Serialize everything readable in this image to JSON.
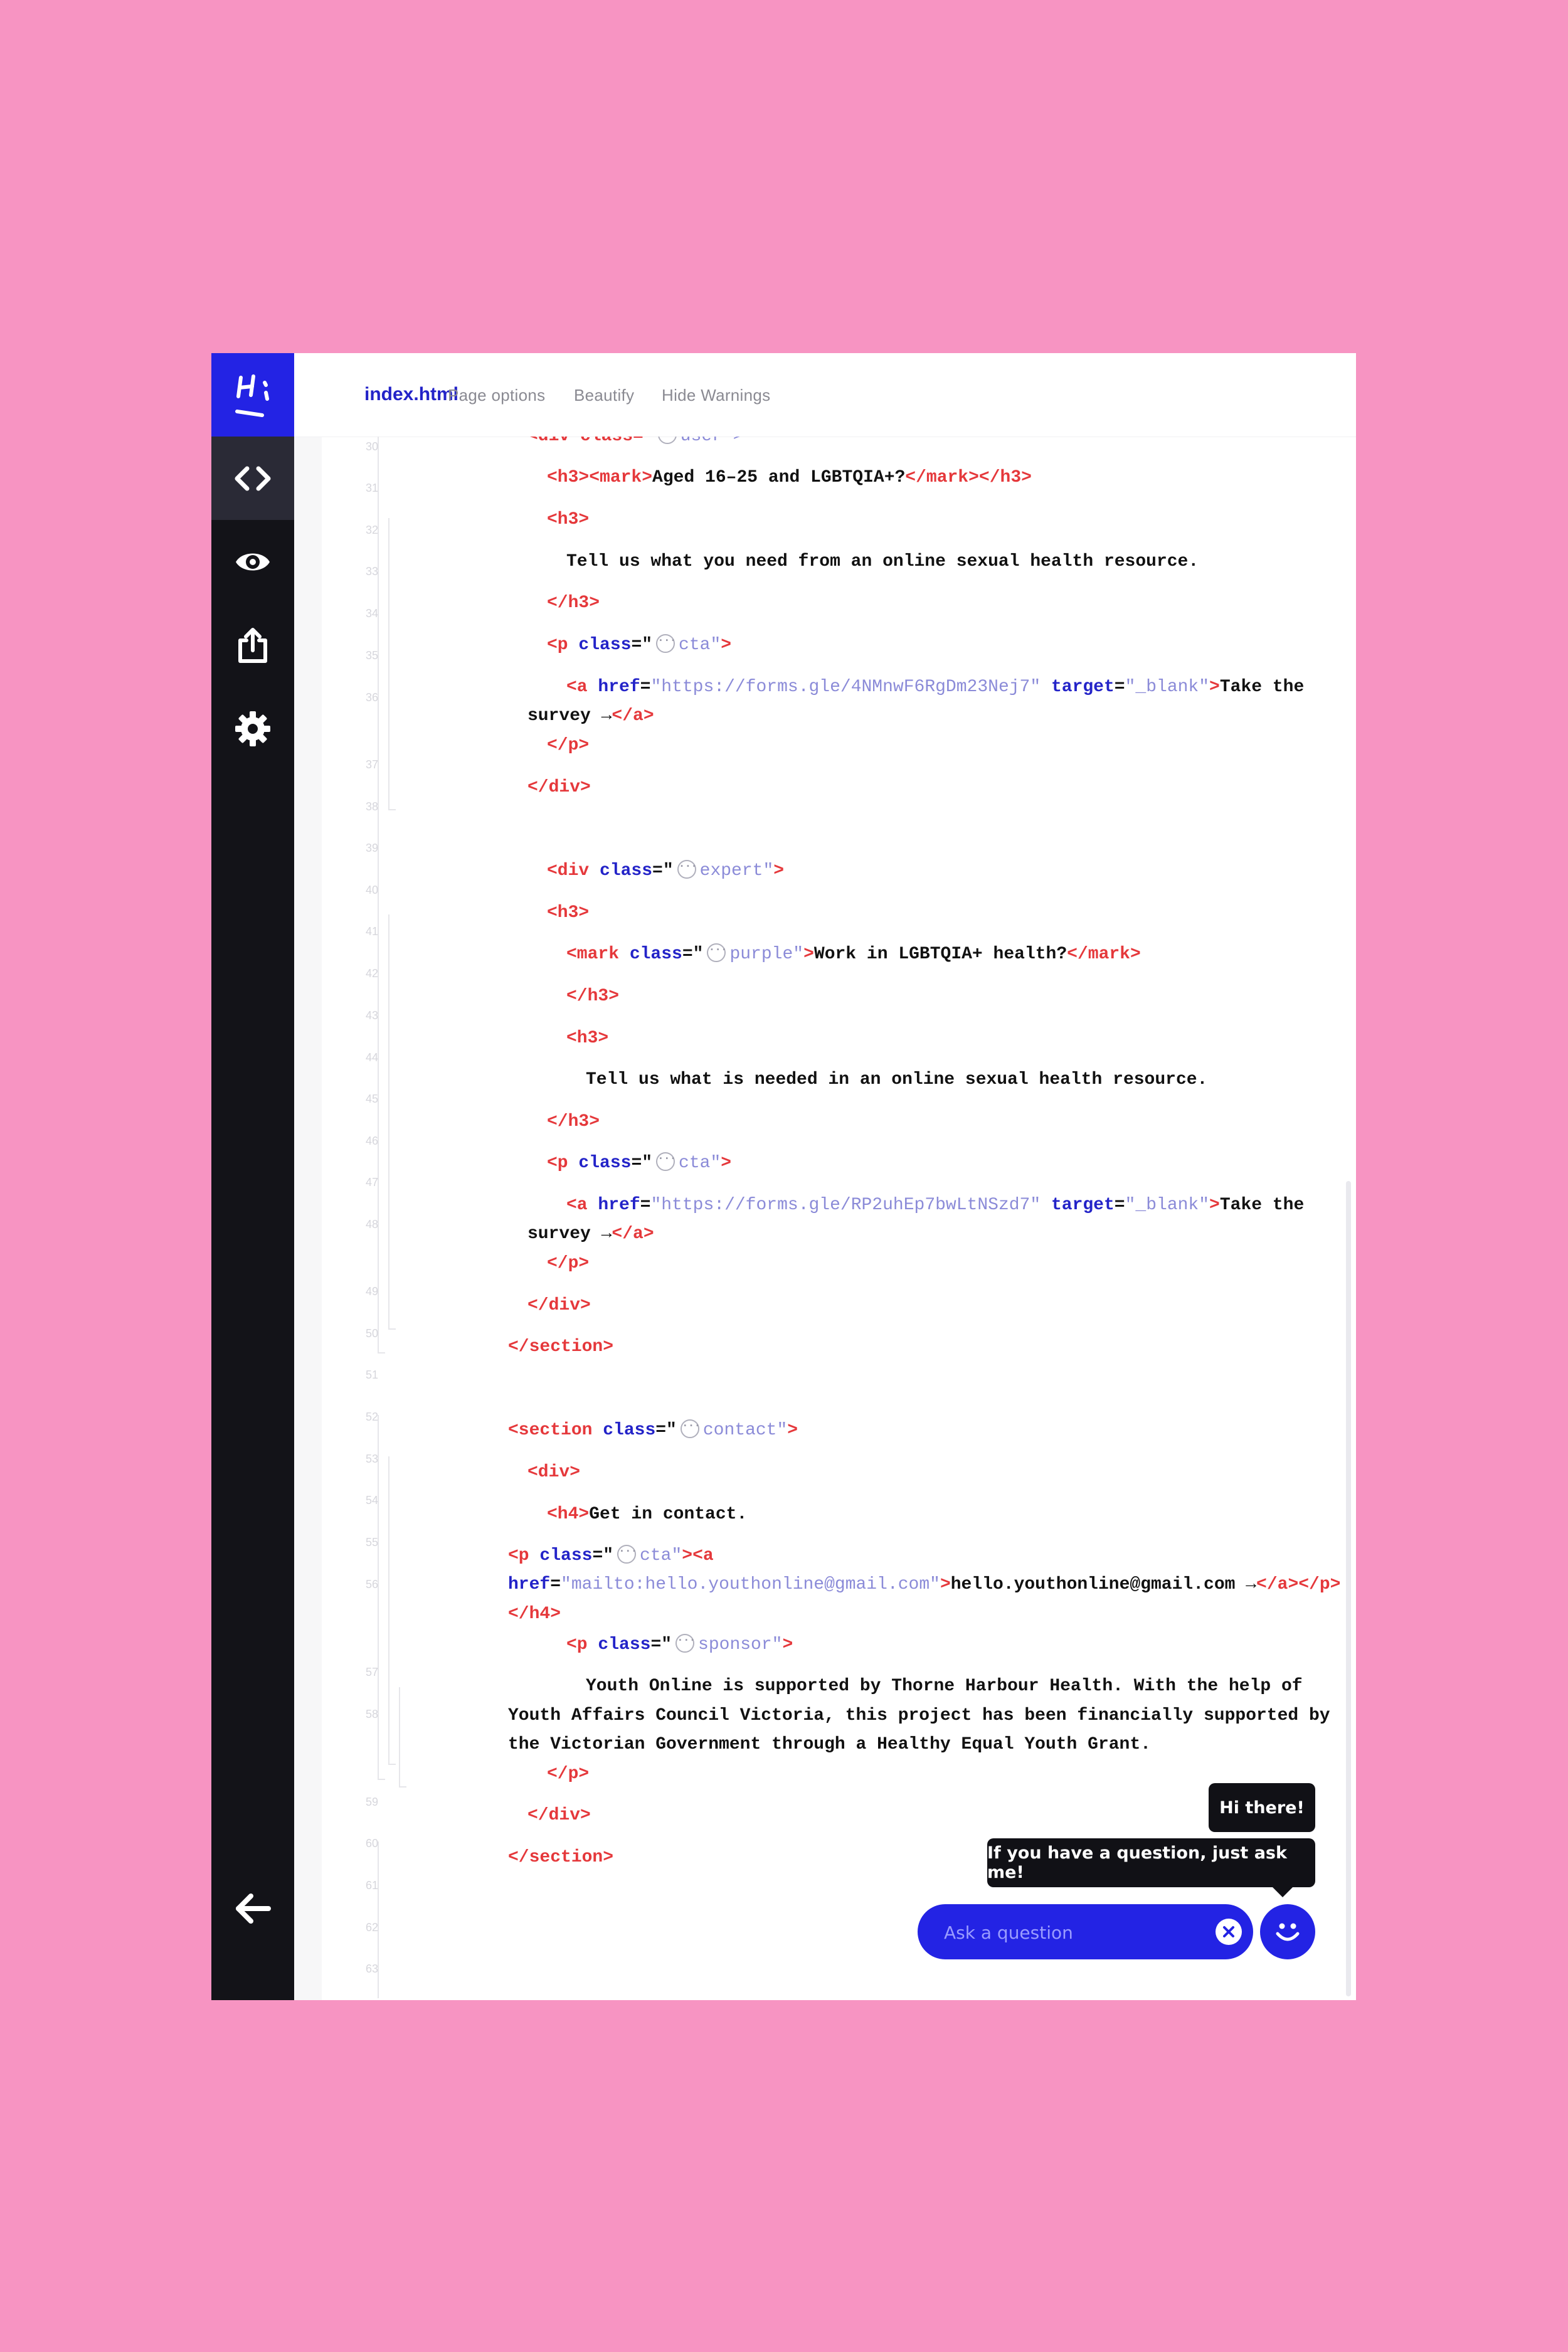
{
  "toolbar": {
    "file_tab": "index.html",
    "page_options": "Page options",
    "beautify": "Beautify",
    "hide_warnings": "Hide Warnings"
  },
  "sidebar": {
    "logo_text": "Hi",
    "items": [
      {
        "name": "code",
        "icon": "code-icon",
        "active": true
      },
      {
        "name": "preview",
        "icon": "eye-icon",
        "active": false
      },
      {
        "name": "share",
        "icon": "share-icon",
        "active": false
      },
      {
        "name": "settings",
        "icon": "gear-icon",
        "active": false
      },
      {
        "name": "back",
        "icon": "arrow-left-icon",
        "active": false
      }
    ]
  },
  "code": {
    "line_numbers": [
      "30",
      "31",
      "32",
      "33",
      "34",
      "35",
      "36",
      "37",
      "38",
      "39",
      "40",
      "41",
      "42",
      "43",
      "44",
      "45",
      "46",
      "47",
      "48",
      "49",
      "50",
      "51",
      "52",
      "53",
      "54",
      "55",
      "56",
      "57",
      "58",
      "59",
      "60",
      "61",
      "62",
      "63"
    ],
    "lines": [
      {
        "t1": "<div class=\"",
        "t2": "user\">"
      },
      {
        "open": "<h3><mark>",
        "text": "Aged 16–25 and LGBTQIA+?",
        "close": "</mark></h3>"
      },
      {
        "tag": "<h3>"
      },
      {
        "text": "Tell us what you need from an online sexual health resource."
      },
      {
        "tag": "</h3>"
      },
      {
        "open": "<p ",
        "attr": "class",
        "eq": "=\"",
        "val": "cta\"",
        "end": ">"
      },
      {
        "open": "<a ",
        "attr": "href",
        "eq": "=",
        "val": "\"https://forms.gle/4NMnwF6RgDm23Nej7\"",
        "attr2": "target",
        "eq2": "=",
        "val2": "\"_blank\"",
        "end": ">",
        "text": "Take the",
        "wrap_text": "survey →",
        "close": "</a>"
      },
      {
        "tag": "</p>"
      },
      {
        "tag": "</div>"
      },
      {
        "tag": ""
      },
      {
        "open": "<div ",
        "attr": "class",
        "eq": "=\"",
        "val": "expert\"",
        "end": ">"
      },
      {
        "tag": "<h3>"
      },
      {
        "open": "<mark ",
        "attr": "class",
        "eq": "=\"",
        "val": "purple\"",
        "end": ">",
        "text": "Work in LGBTQIA+ health?",
        "close": "</mark>"
      },
      {
        "tag": "</h3>"
      },
      {
        "tag": "<h3>"
      },
      {
        "text": "Tell us what is needed in an online sexual health resource."
      },
      {
        "tag": "</h3>"
      },
      {
        "open": "<p ",
        "attr": "class",
        "eq": "=\"",
        "val": "cta\"",
        "end": ">"
      },
      {
        "open": "<a ",
        "attr": "href",
        "eq": "=",
        "val": "\"https://forms.gle/RP2uhEp7bwLtNSzd7\"",
        "attr2": "target",
        "eq2": "=",
        "val2": "\"_blank\"",
        "end": ">",
        "text": "Take the",
        "wrap_text": "survey →",
        "close": "</a>"
      },
      {
        "tag": "</p>"
      },
      {
        "tag": "</div>"
      },
      {
        "tag": "</section>"
      },
      {
        "tag": ""
      },
      {
        "open": "<section ",
        "attr": "class",
        "eq": "=\"",
        "val": "contact\"",
        "end": ">"
      },
      {
        "tag": "<div>"
      },
      {
        "open": "<h4>",
        "text": "Get in contact."
      },
      {
        "open": "<p ",
        "attr": "class",
        "eq": "=\"",
        "val": "cta\"",
        "end": "><a",
        "wrap_attr": "href",
        "wrap_eq": "=",
        "wrap_val": "\"mailto:hello.youthonline@gmail.com\"",
        "wrap_end": ">",
        "wrap_text": "hello.youthonline@gmail.com →",
        "wrap_close": "</a></p>",
        "wrap_close2": "</h4>"
      },
      {
        "open": "<p ",
        "attr": "class",
        "eq": "=\"",
        "val": "sponsor\"",
        "end": ">"
      },
      {
        "text": "Youth Online is supported by Thorne Harbour Health. With the help of",
        "wrap_text": "Youth Affairs Council Victoria, this project has been financially supported by",
        "wrap_text2": "the Victorian Government through a Healthy Equal Youth Grant."
      },
      {
        "tag": "</p>"
      },
      {
        "tag": "</div>"
      },
      {
        "tag": "</section>"
      }
    ]
  },
  "chat": {
    "greeting": "Hi there!",
    "prompt": "If you have a question, just ask me!",
    "input_placeholder": "Ask a question"
  },
  "colors": {
    "background": "#f794c2",
    "brand_blue": "#2323e4",
    "rail": "#131318",
    "active_indicator": "#f2d03b",
    "tag": "#e5383b",
    "attr": "#2323c8",
    "value": "#8b8bd8"
  }
}
